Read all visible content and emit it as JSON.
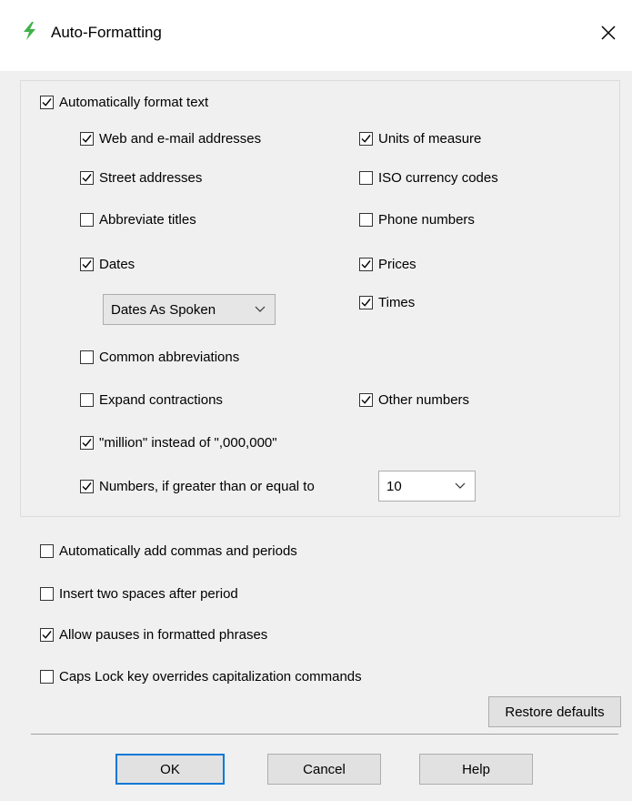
{
  "window": {
    "title": "Auto-Formatting",
    "icon": "lightning-bolt-icon",
    "accent": "#3fb24a"
  },
  "auto_format": {
    "label": "Automatically format text",
    "checked": true
  },
  "options": {
    "web_email": {
      "label": "Web and e-mail addresses",
      "checked": true
    },
    "street": {
      "label": "Street addresses",
      "checked": true
    },
    "abbrev_titles": {
      "label": "Abbreviate titles",
      "checked": false
    },
    "dates": {
      "label": "Dates",
      "checked": true
    },
    "dates_format": "Dates As Spoken",
    "common_abbrev": {
      "label": "Common abbreviations",
      "checked": false
    },
    "expand_contr": {
      "label": "Expand contractions",
      "checked": false
    },
    "million": {
      "label": "\"million\" instead of \",000,000\"",
      "checked": true
    },
    "numbers": {
      "label": "Numbers, if greater than or equal to",
      "checked": true
    },
    "numbers_value": "10",
    "units": {
      "label": "Units of measure",
      "checked": true
    },
    "iso": {
      "label": "ISO currency codes",
      "checked": false
    },
    "phone": {
      "label": "Phone numbers",
      "checked": false
    },
    "prices": {
      "label": "Prices",
      "checked": true
    },
    "times": {
      "label": "Times",
      "checked": true
    },
    "other_numbers": {
      "label": "Other numbers",
      "checked": true
    }
  },
  "bottom": {
    "commas": {
      "label": "Automatically add commas and periods",
      "checked": false
    },
    "two_spaces": {
      "label": "Insert two spaces after period",
      "checked": false
    },
    "pauses": {
      "label": "Allow pauses in formatted phrases",
      "checked": true
    },
    "caps_lock": {
      "label": "Caps Lock key overrides capitalization commands",
      "checked": false
    }
  },
  "buttons": {
    "restore": "Restore defaults",
    "ok": "OK",
    "cancel": "Cancel",
    "help": "Help"
  }
}
